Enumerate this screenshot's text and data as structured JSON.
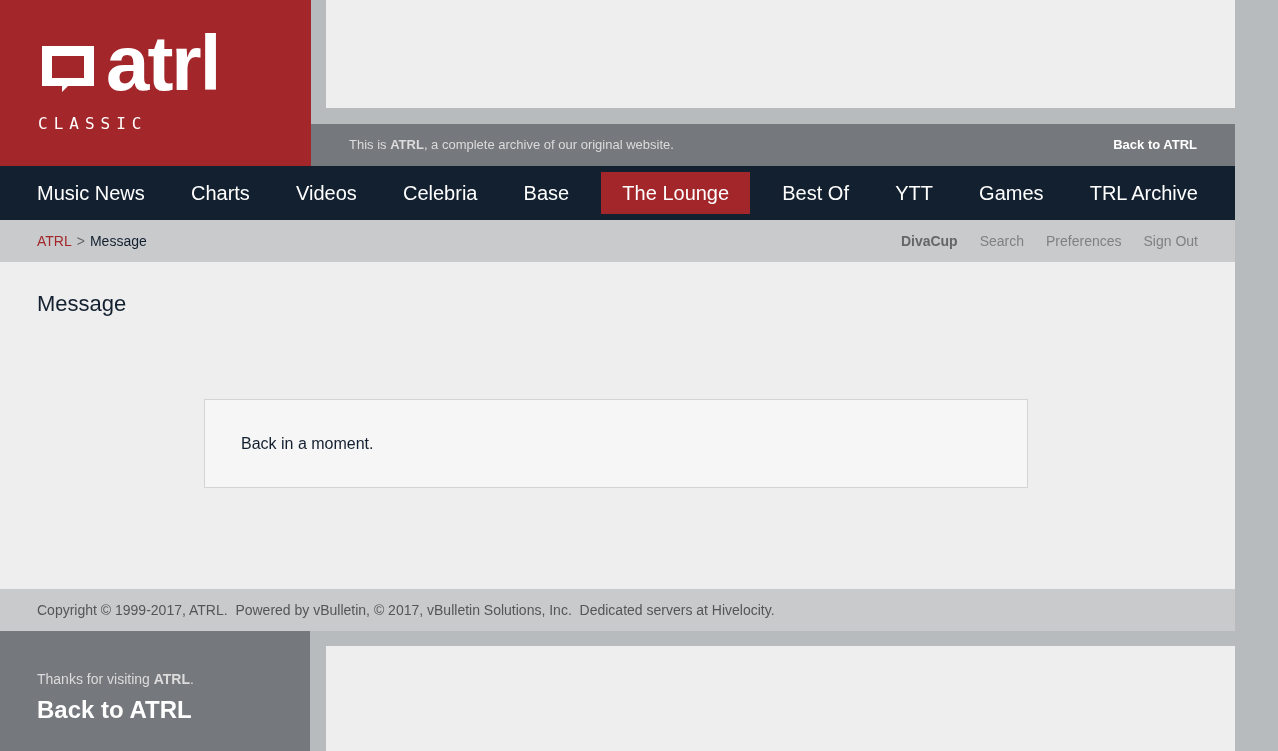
{
  "logo": {
    "wordmark": "atrl",
    "subtitle": "CLASSIC"
  },
  "notice_bar": {
    "text": "This is **ATRL**, a complete archive of our original website.",
    "link": "Back to ATRL"
  },
  "nav": [
    {
      "label": "Music News",
      "selected": false
    },
    {
      "label": "Charts",
      "selected": false
    },
    {
      "label": "Videos",
      "selected": false
    },
    {
      "label": "Celebria",
      "selected": false
    },
    {
      "label": "Base",
      "selected": false
    },
    {
      "label": "The Lounge",
      "selected": true
    },
    {
      "label": "Best Of",
      "selected": false
    },
    {
      "label": "YTT",
      "selected": false
    },
    {
      "label": "Games",
      "selected": false
    },
    {
      "label": "TRL Archive",
      "selected": false
    }
  ],
  "breadcrumb": {
    "items": [
      "ATRL",
      "Message"
    ],
    "separator": ">"
  },
  "user_links": [
    {
      "label": "DivaCup",
      "kind": "user"
    },
    {
      "label": "Search",
      "kind": "link"
    },
    {
      "label": "Preferences",
      "kind": "link"
    },
    {
      "label": "Sign Out",
      "kind": "link"
    }
  ],
  "page_title": "Message",
  "message": "Back in a moment.",
  "footer": {
    "copyright": "Copyright © 1999-2017, ATRL.  Powered by vBulletin, © 2017, vBulletin Solutions, Inc.  Dedicated servers at Hivelocity."
  },
  "bottom_panel": {
    "thanks": "Thanks for visiting **ATRL**.",
    "link": "Back to ATRL"
  }
}
